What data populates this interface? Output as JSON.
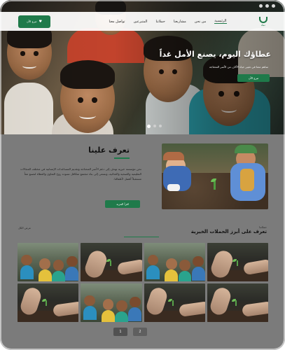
{
  "topbar": {
    "dots": 3
  },
  "navbar": {
    "donate_label": "تبرع الآن",
    "links": [
      "الرئيسية",
      "من نحن",
      "مشاريعنا",
      "حملاتنا",
      "المتبرعين",
      "تواصل معنا"
    ],
    "logo_text": "عطاء"
  },
  "hero": {
    "title": "عطاؤك اليوم، يصنع الأمل غداً",
    "subtitle": "ساهم معنا في تغيير حياة الآلاف من الأسر المحتاجة",
    "cta_label": "تبرع الآن"
  },
  "about": {
    "title": "تعرف علينا",
    "text": "نحن مؤسسة خيرية تهدف إلى دعم الأسر المحتاجة وتقديم المساعدات الإنسانية في مختلف المجالات التعليمية والصحية والغذائية، ونسعى إلى بناء مجتمع متكافل تسوده روح التعاون والعطاء لنصنع معاً مستقبلاً أفضل لأطفالنا.",
    "cta_label": "اقرأ المزيد"
  },
  "campaigns": {
    "small_label": "حملاتنا",
    "title": "تعرف على أبرز الحملات الخيرية",
    "left_label": "عرض الكل",
    "pager": [
      "1",
      "2"
    ]
  },
  "colors": {
    "accent": "#1f7a4a"
  }
}
